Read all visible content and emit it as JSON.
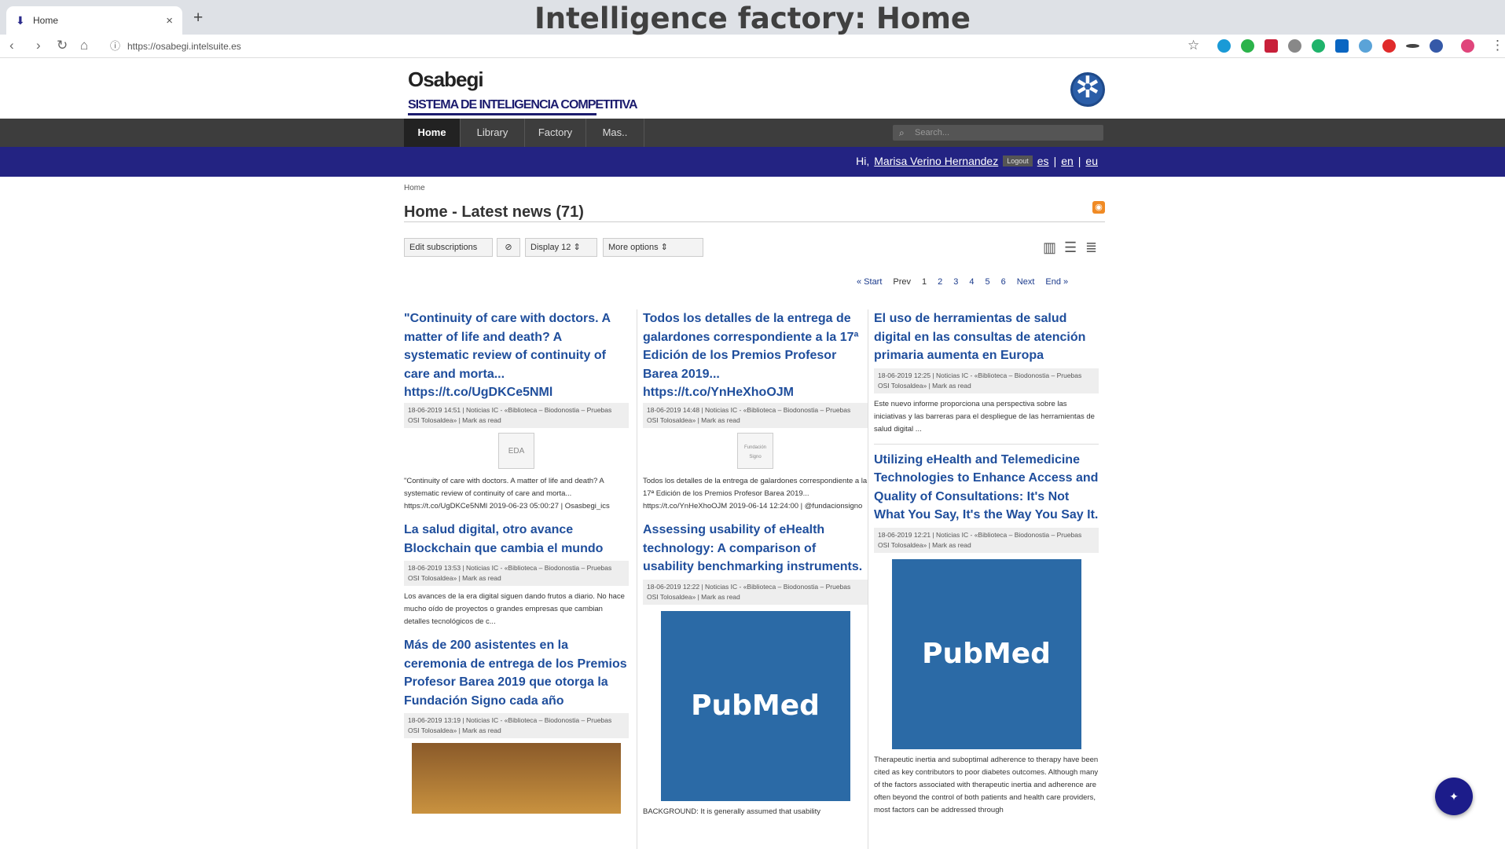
{
  "overlay_title": "Intelligence factory: Home",
  "browser": {
    "tab_title": "Home",
    "url": "https://osabegi.intelsuite.es"
  },
  "site": {
    "logo_name": "Osabegi",
    "logo_sub": "SISTEMA DE INTELIGENCIA COMPETITIVA"
  },
  "nav": {
    "items": [
      {
        "label": "Home"
      },
      {
        "label": "Library"
      },
      {
        "label": "Factory"
      },
      {
        "label": "Mas.."
      }
    ],
    "search_placeholder": "Search..."
  },
  "userbar": {
    "greeting": "Hi,",
    "user": "Marisa Verino Hernandez",
    "logout": "Logout",
    "langs": [
      "es",
      "en",
      "eu"
    ]
  },
  "breadcrumb": "Home",
  "page_title": "Home - Latest news (71)",
  "toolbar": {
    "edit_subscriptions": "Edit subscriptions",
    "display_label": "Display",
    "display_value": "12",
    "more_options": "More options"
  },
  "pager": [
    "« Start",
    "Prev",
    "1",
    "2",
    "3",
    "4",
    "5",
    "6",
    "Next",
    "End »"
  ],
  "columns": [
    [
      {
        "title": "\"Continuity of care with doctors. A matter of life and death? A systematic review of continuity of care and morta...",
        "link": "https://t.co/UgDKCe5NMl",
        "meta": "18-06-2019 14:51 | Noticias IC - «Biblioteca – Biodonostia – Pruebas OSI Tolosaldea» | Mark as read",
        "thumb": "EDA",
        "snippet": "\"Continuity of care with doctors. A matter of life and death? A systematic review of continuity of care and morta... https://t.co/UgDKCe5NMl 2019-06-23 05:00:27 | Osasbegi_ics"
      },
      {
        "title": "La salud digital, otro avance Blockchain que cambia el mundo",
        "meta": "18-06-2019 13:53 | Noticias IC - «Biblioteca – Biodonostia – Pruebas OSI Tolosaldea» | Mark as read",
        "snippet": "Los avances de la era digital siguen dando frutos a diario. No hace mucho oído de proyectos o grandes empresas que cambian detalles tecnológicos de c..."
      },
      {
        "title": "Más de 200 asistentes en la ceremonia de entrega de los Premios Profesor Barea 2019 que otorga la Fundación Signo cada año",
        "meta": "18-06-2019 13:19 | Noticias IC - «Biblioteca – Biodonostia – Pruebas OSI Tolosaldea» | Mark as read"
      }
    ],
    [
      {
        "title": "Todos los detalles de la entrega de galardones correspondiente a la 17ª Edición de los Premios Profesor Barea 2019...",
        "link": "https://t.co/YnHeXhoOJM",
        "meta": "18-06-2019 14:48 | Noticias IC - «Biblioteca – Biodonostia – Pruebas OSI Tolosaldea» | Mark as read",
        "thumb": "Fundación Signo",
        "snippet": "Todos los detalles de la entrega de galardones correspondiente a la 17ª Edición de los Premios Profesor Barea 2019... https://t.co/YnHeXhoOJM 2019-06-14 12:24:00 | @fundacionsigno"
      },
      {
        "title": "Assessing usability of eHealth technology: A comparison of usability benchmarking instruments.",
        "meta": "18-06-2019 12:22 | Noticias IC - «Biblioteca – Biodonostia – Pruebas OSI Tolosaldea» | Mark as read",
        "image": "PubMed",
        "snippet": "BACKGROUND: It is generally assumed that usability"
      }
    ],
    [
      {
        "title": "El uso de herramientas de salud digital en las consultas de atención primaria aumenta en Europa",
        "meta": "18-06-2019 12:25 | Noticias IC - «Biblioteca – Biodonostia – Pruebas OSI Tolosaldea» | Mark as read",
        "snippet": "Este nuevo informe proporciona una perspectiva sobre las iniciativas y las barreras para el despliegue de las herramientas de salud digital ..."
      },
      {
        "title": "Utilizing eHealth and Telemedicine Technologies to Enhance Access and Quality of Consultations: It's Not What You Say, It's the Way You Say It.",
        "meta": "18-06-2019 12:21 | Noticias IC - «Biblioteca – Biodonostia – Pruebas OSI Tolosaldea» | Mark as read",
        "image": "PubMed",
        "snippet": "Therapeutic inertia and suboptimal adherence to therapy have been cited as key contributors to poor diabetes outcomes. Although many of the factors associated with therapeutic inertia and adherence are often beyond the control of both patients and health care providers, most factors can be addressed through"
      }
    ]
  ]
}
